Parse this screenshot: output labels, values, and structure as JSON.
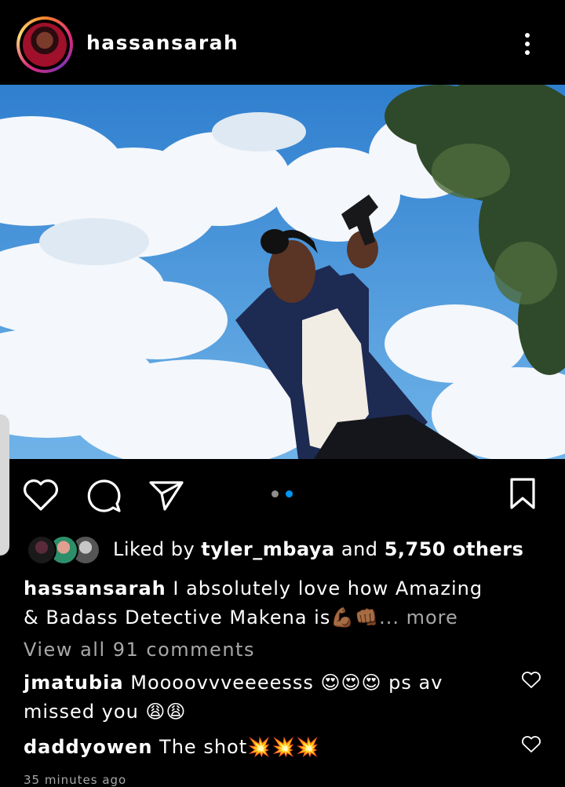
{
  "post_header": {
    "username": "hassansarah"
  },
  "actions": {
    "like_icon": "heart-outline-icon",
    "comment_icon": "speech-bubble-icon",
    "share_icon": "paper-plane-icon",
    "save_icon": "bookmark-icon",
    "carousel_pages": 2,
    "carousel_active_index": 1,
    "dot_active_color": "#0095f6",
    "dot_inactive_color": "#8e8e8e"
  },
  "likes": {
    "prefix": "Liked by",
    "top_liker": "tyler_mbaya",
    "joiner": "and",
    "others": "5,750 others"
  },
  "caption": {
    "username": "hassansarah",
    "text": "I absolutely love how Amazing & Badass Detective Makena is💪🏾👊🏾",
    "more": "... more"
  },
  "comments_link": "View all 91 comments",
  "comments": [
    {
      "username": "jmatubia",
      "text": "Moooovvveeeesss 😍😍😍 ps av missed you 😩😩"
    },
    {
      "username": "daddyowen",
      "text": "The shot💥💥💥"
    }
  ],
  "timestamp": "35 minutes ago"
}
